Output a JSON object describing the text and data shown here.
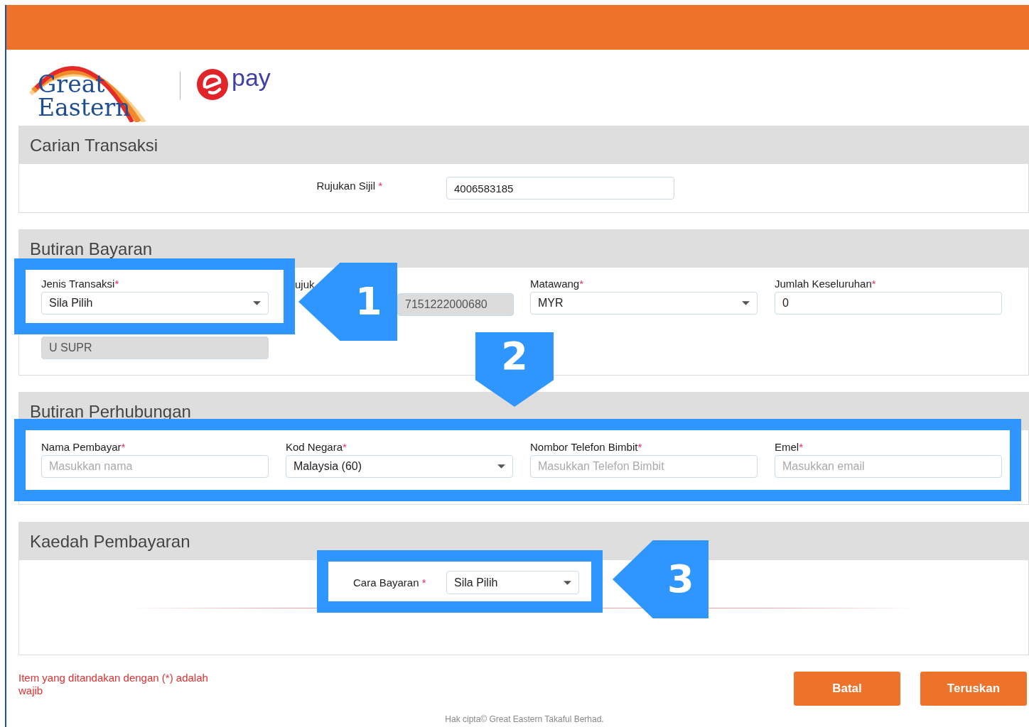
{
  "logo": {
    "brand_line_1": "Great",
    "brand_line_2": "Eastern",
    "product": "pay"
  },
  "search_section": {
    "title": "Carian Transaksi",
    "field": {
      "label": "Rujukan Sijil",
      "required_mark": "*",
      "value": "4006583185"
    }
  },
  "payment_section": {
    "title": "Butiran Bayaran",
    "fields": [
      {
        "kind": "select",
        "label": "Jenis Transaksi",
        "required_mark": "*",
        "value": "Sila Pilih",
        "disabled": false
      },
      {
        "kind": "split",
        "label": "ujuk",
        "value": "7151222000680",
        "disabled": true
      },
      {
        "kind": "select",
        "label": "Matawang",
        "required_mark": "*",
        "value": "MYR",
        "disabled": false
      },
      {
        "kind": "text",
        "label": "Jumlah Keseluruhan",
        "required_mark": "*",
        "value": "0",
        "disabled": false
      },
      {
        "kind": "text",
        "value": "U SUPR",
        "disabled": true
      }
    ]
  },
  "contact_section": {
    "title": "Butiran Perhubungan",
    "fields": [
      {
        "kind": "text",
        "label": "Nama Pembayar",
        "required_mark": "*",
        "placeholder": "Masukkan nama",
        "disabled": false
      },
      {
        "kind": "select",
        "label": "Kod Negara",
        "required_mark": "*",
        "value": "Malaysia (60)",
        "disabled": false
      },
      {
        "kind": "text",
        "label": "Nombor Telefon Bimbit",
        "required_mark": "*",
        "placeholder": "Masukkan Telefon Bimbit",
        "disabled": false
      },
      {
        "kind": "text",
        "label": "Emel",
        "required_mark": "*",
        "placeholder": "Masukkan email",
        "disabled": false
      }
    ]
  },
  "method_section": {
    "title": "Kaedah Pembayaran",
    "field": {
      "label": "Cara Bayaran",
      "required_mark": "*",
      "value": "Sila Pilih"
    }
  },
  "required_note": "Item yang ditandakan dengan (*) adalah wajib",
  "buttons": [
    {
      "label": "Batal"
    },
    {
      "label": "Teruskan"
    }
  ],
  "copyright": "Hak cipta© Great Eastern Takaful Berhad.",
  "callouts": [
    {
      "number": "1"
    },
    {
      "number": "2"
    },
    {
      "number": "3"
    }
  ]
}
